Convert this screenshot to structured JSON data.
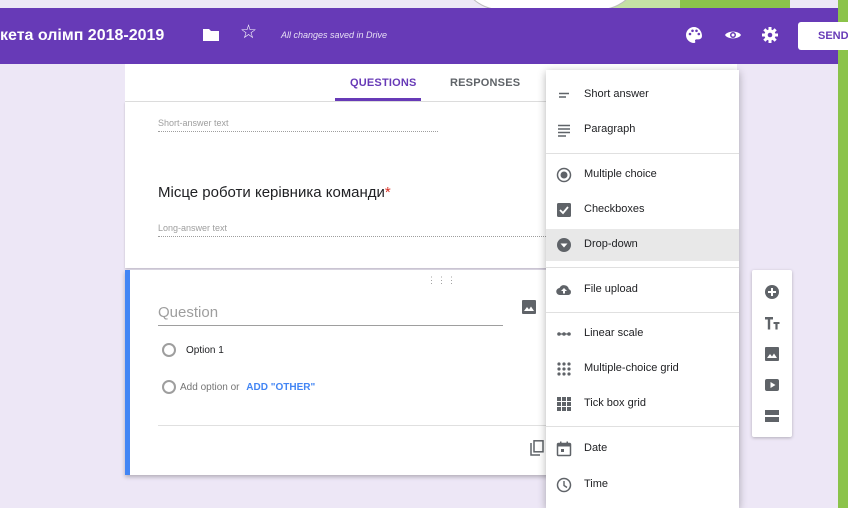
{
  "app": {
    "title": "кета олімп 2018-2019",
    "save_status": "All changes saved in Drive",
    "send_label": "SEND"
  },
  "tabs": [
    {
      "label": "QUESTIONS",
      "active": true
    },
    {
      "label": "RESPONSES",
      "active": false
    }
  ],
  "form": {
    "short_answer_hint": "Short-answer text",
    "question_title": "Місце роботи керівника команди",
    "required_mark": "*",
    "long_answer_hint": "Long-answer text",
    "active_question": {
      "placeholder": "Question",
      "option_1": "Option 1",
      "add_option": "Add option",
      "or_text": "or",
      "add_other": "ADD \"OTHER\""
    }
  },
  "type_menu": {
    "items": [
      {
        "label": "Short answer",
        "icon": "short-answer-icon"
      },
      {
        "label": "Paragraph",
        "icon": "paragraph-icon"
      },
      {
        "label": "Multiple choice",
        "icon": "radio-icon"
      },
      {
        "label": "Checkboxes",
        "icon": "checkbox-icon"
      },
      {
        "label": "Drop-down",
        "icon": "dropdown-icon",
        "selected": true
      },
      {
        "label": "File upload",
        "icon": "cloud-upload-icon"
      },
      {
        "label": "Linear scale",
        "icon": "linear-scale-icon"
      },
      {
        "label": "Multiple-choice grid",
        "icon": "dot-grid-icon"
      },
      {
        "label": "Tick box grid",
        "icon": "box-grid-icon"
      },
      {
        "label": "Date",
        "icon": "calendar-icon"
      },
      {
        "label": "Time",
        "icon": "clock-icon"
      }
    ]
  },
  "colors": {
    "header": "#673ab7",
    "accent_blue": "#4285f4",
    "background": "#ede7f6",
    "required": "#d93025"
  }
}
